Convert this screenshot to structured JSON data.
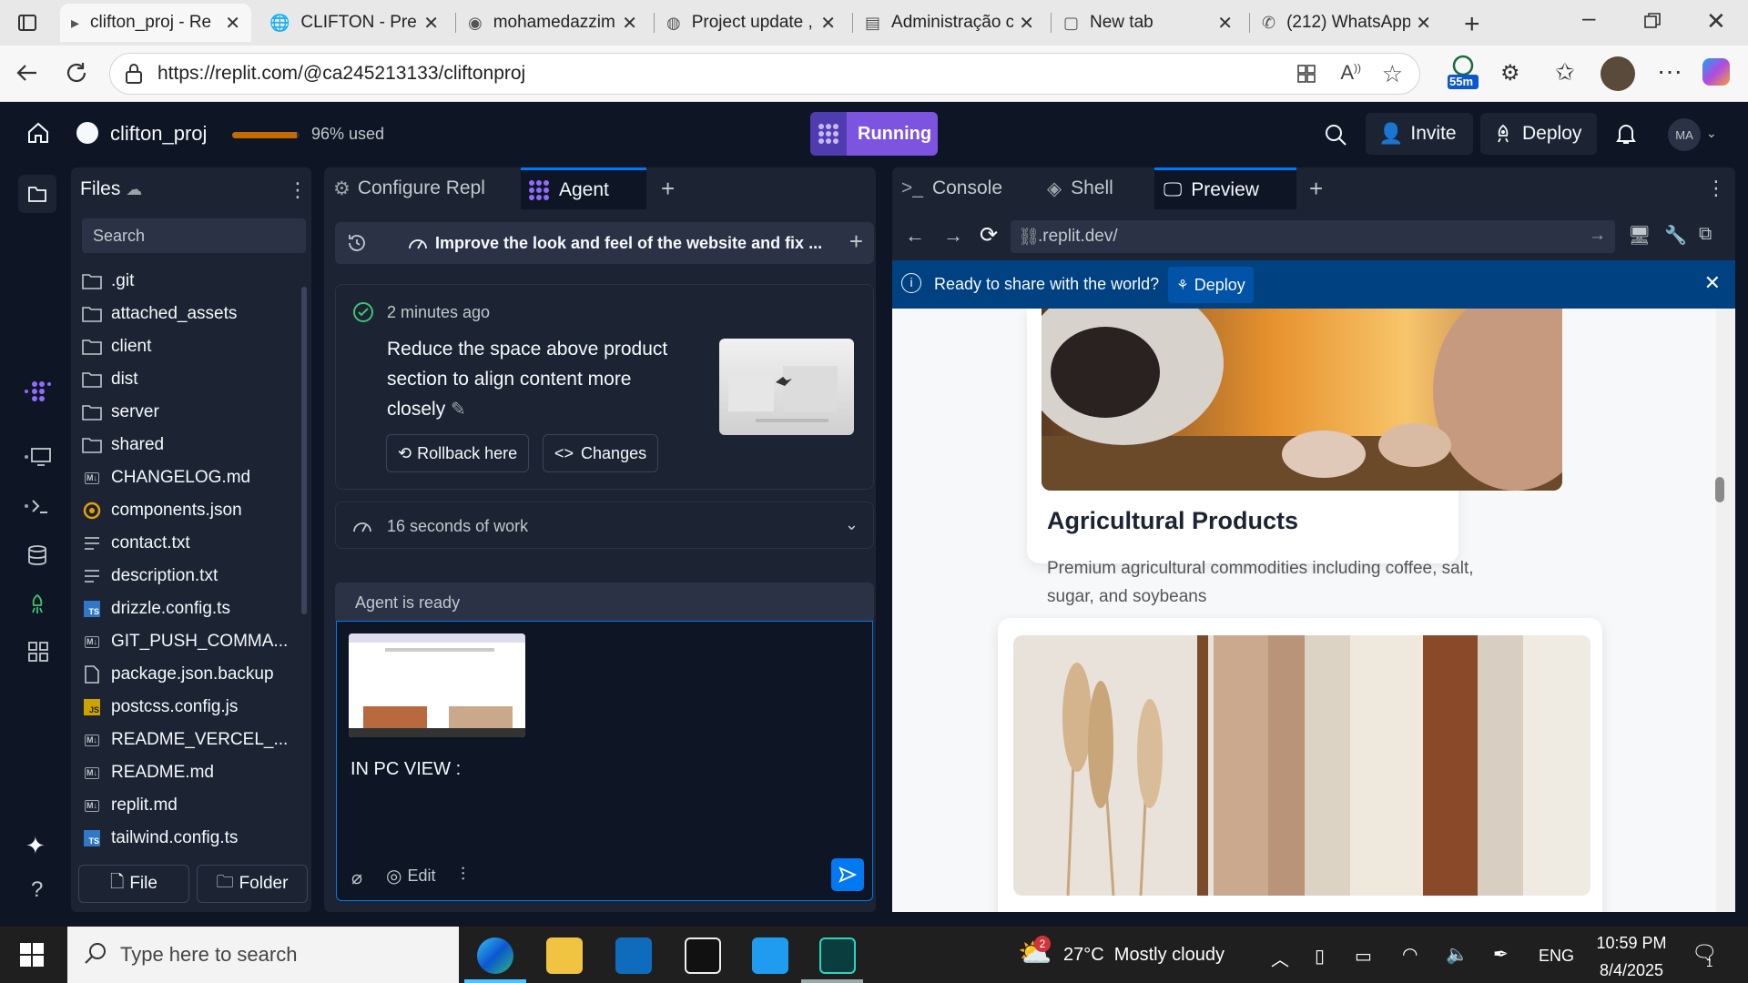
{
  "browser": {
    "tabs": [
      {
        "title": "clifton_proj - Re",
        "active": true
      },
      {
        "title": "CLIFTON - Prem",
        "active": false
      },
      {
        "title": "mohamedazzim",
        "active": false
      },
      {
        "title": "Project update ,",
        "active": false
      },
      {
        "title": "Administração c",
        "active": false
      },
      {
        "title": "New tab",
        "active": false
      },
      {
        "title": "(212) WhatsApp",
        "active": false
      }
    ],
    "url": "https://replit.com/@ca245213133/cliftonproj",
    "badge": "55m"
  },
  "app": {
    "project_name": "clifton_proj",
    "usage_text": "96% used",
    "usage_fraction": 0.96,
    "status_label": "Running",
    "invite_label": "Invite",
    "deploy_label": "Deploy",
    "avatar_initials": "MA"
  },
  "files": {
    "title": "Files",
    "search_placeholder": "Search",
    "items": [
      {
        "name": ".git",
        "type": "folder"
      },
      {
        "name": "attached_assets",
        "type": "folder"
      },
      {
        "name": "client",
        "type": "folder"
      },
      {
        "name": "dist",
        "type": "folder"
      },
      {
        "name": "server",
        "type": "folder"
      },
      {
        "name": "shared",
        "type": "folder"
      },
      {
        "name": "CHANGELOG.md",
        "type": "md"
      },
      {
        "name": "components.json",
        "type": "json"
      },
      {
        "name": "contact.txt",
        "type": "txt"
      },
      {
        "name": "description.txt",
        "type": "txt"
      },
      {
        "name": "drizzle.config.ts",
        "type": "ts"
      },
      {
        "name": "GIT_PUSH_COMMA...",
        "type": "md"
      },
      {
        "name": "package.json.backup",
        "type": "file"
      },
      {
        "name": "postcss.config.js",
        "type": "js"
      },
      {
        "name": "README_VERCEL_...",
        "type": "md"
      },
      {
        "name": "README.md",
        "type": "md"
      },
      {
        "name": "replit.md",
        "type": "md"
      },
      {
        "name": "tailwind.config.ts",
        "type": "ts"
      }
    ],
    "new_file_label": "File",
    "new_folder_label": "Folder"
  },
  "agent": {
    "tabs": [
      "Configure Repl",
      "Agent"
    ],
    "task_title": "Improve the look and feel of the website and fix ...",
    "checkpoint_time": "2 minutes ago",
    "checkpoint_message": "Reduce the space above product section to align content more closely",
    "rollback_label": "Rollback here",
    "changes_label": "Changes",
    "work_summary": "16 seconds of work",
    "status": "Agent is ready",
    "input_text": "IN PC VIEW :",
    "edit_label": "Edit"
  },
  "preview": {
    "tabs": [
      "Console",
      "Shell",
      "Preview"
    ],
    "url": ".replit.dev/",
    "banner_text": "Ready to share with the world?",
    "banner_deploy": "Deploy",
    "product_title": "Agricultural Products",
    "product_desc": "Premium agricultural commodities including coffee, salt, sugar, and soybeans"
  },
  "taskbar": {
    "search_placeholder": "Type here to search",
    "weather": "27°C  Mostly cloudy",
    "weather_badge": "2",
    "language": "ENG",
    "time": "10:59 PM",
    "date": "8/4/2025",
    "notifications": "1"
  }
}
